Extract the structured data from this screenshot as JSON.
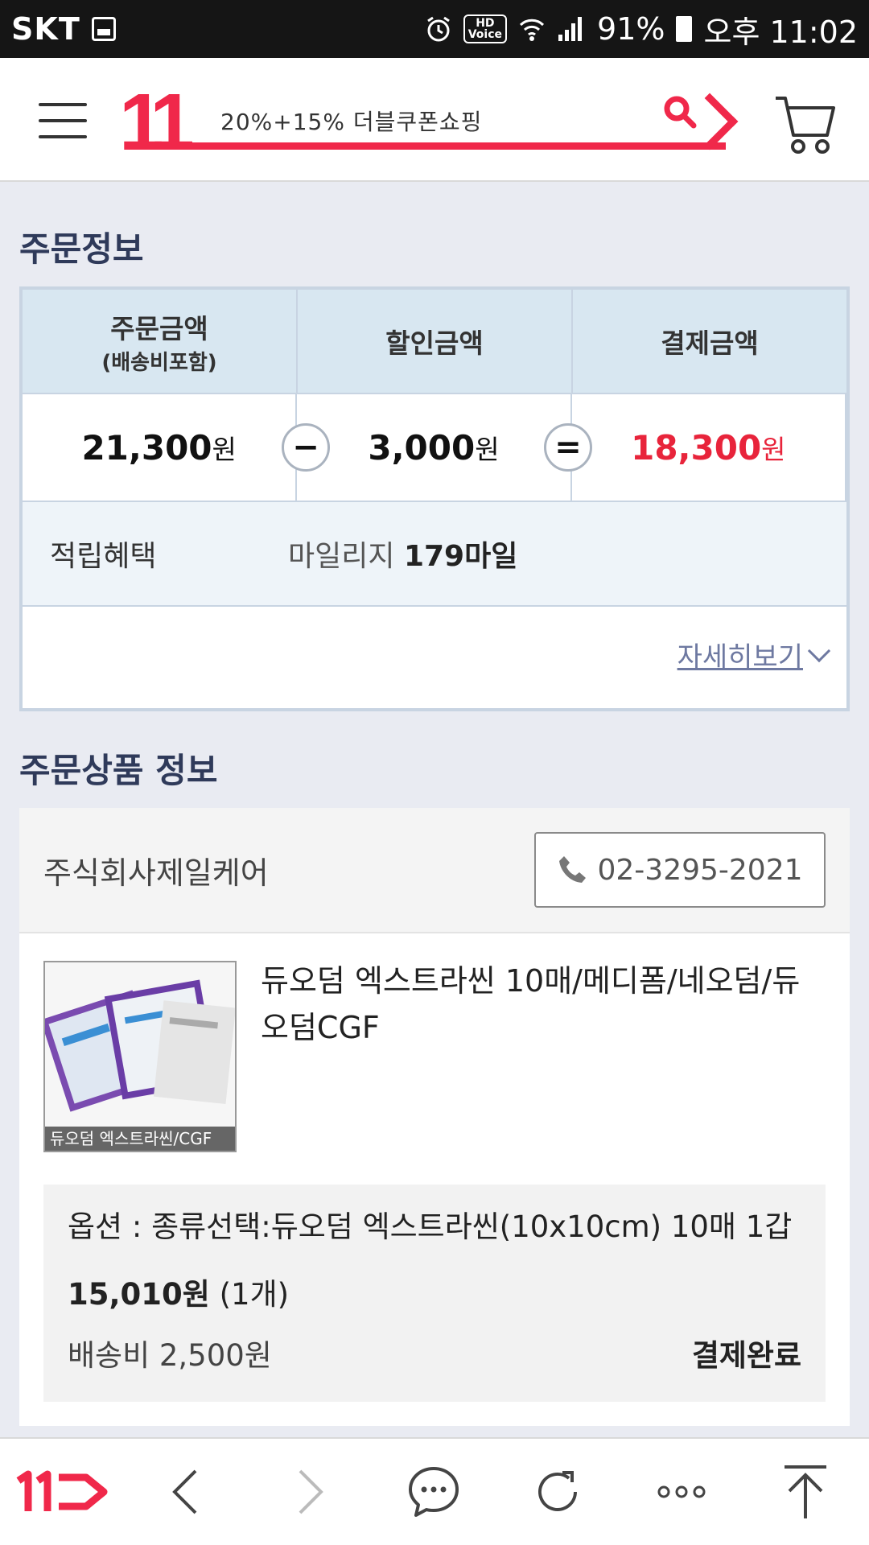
{
  "status_bar": {
    "carrier": "SKT",
    "hd_voice_top": "HD",
    "hd_voice_bottom": "Voice",
    "battery": "91%",
    "time": "오후 11:02"
  },
  "header": {
    "logo": "11",
    "search_text": "20%+15% 더블쿠폰쇼핑"
  },
  "order_info": {
    "title": "주문정보",
    "headers": {
      "order_amount": "주문금액",
      "order_amount_sub": "(배송비포함)",
      "discount_amount": "할인금액",
      "payment_amount": "결제금액"
    },
    "values": {
      "order_amount": "21,300",
      "discount_amount": "3,000",
      "payment_amount": "18,300",
      "currency": "원",
      "minus": "−",
      "equals": "="
    },
    "earn_label": "적립혜택",
    "earn_prefix": "마일리지",
    "earn_value": "179마일",
    "detail_link": "자세히보기"
  },
  "product_info": {
    "title": "주문상품 정보",
    "seller": "주식회사제일케어",
    "phone": "02-3295-2021",
    "thumb_caption": "듀오덤 엑스트라씬/CGF",
    "product_name": "듀오덤 엑스트라씬 10매/메디폼/네오덤/듀오덤CGF",
    "option": "옵션 : 종류선택:듀오덤 엑스트라씬(10x10cm) 10매 1갑",
    "price": "15,010원",
    "quantity": "(1개)",
    "shipping": "배송비 2,500원",
    "status": "결제완료"
  },
  "colors": {
    "brand_red": "#f0284a",
    "price_red": "#e8243b",
    "title_navy": "#2f3a5a",
    "link": "#6e79a1"
  }
}
